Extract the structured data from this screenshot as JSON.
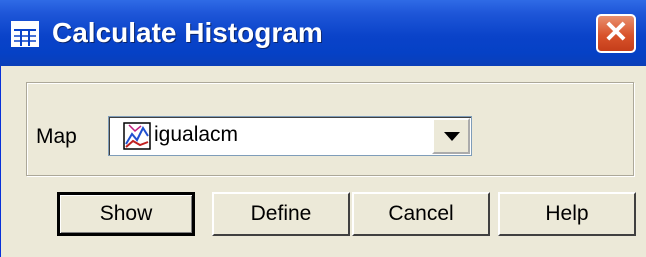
{
  "window": {
    "title": "Calculate Histogram",
    "close_glyph": "✕",
    "title_icon": "table-icon"
  },
  "form": {
    "map_label": "Map",
    "map_value": "igualacm",
    "map_icon": "map-layer-icon"
  },
  "buttons": {
    "show": "Show",
    "define": "Define",
    "cancel": "Cancel",
    "help": "Help"
  },
  "colors": {
    "titlebar": "#0A43C9",
    "face": "#ECE9D8",
    "close": "#D9532B"
  }
}
